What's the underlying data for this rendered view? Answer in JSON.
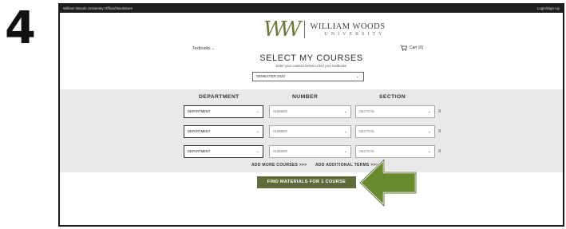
{
  "step_number": "4",
  "topbar": {
    "left_text": "William Woods University Official Bookstore",
    "right_text": "Login/Sign Up"
  },
  "logo": {
    "mark": "WW",
    "line1": "WILLIAM WOODS",
    "line2": "UNIVERSITY"
  },
  "nav": {
    "textbooks_label": "Textbooks",
    "cart_label": "Cart (0)"
  },
  "page": {
    "title": "SELECT MY COURSES",
    "subtitle": "Enter your courses below to find your textbooks"
  },
  "term_select": {
    "value": "SEMESTER 2020"
  },
  "columns": [
    "DEPARTMENT",
    "NUMBER",
    "SECTION"
  ],
  "rows": [
    {
      "department": "DEPARTMENT",
      "number": "NUMBER",
      "section": "SECTION"
    },
    {
      "department": "DEPARTMENT",
      "number": "NUMBER",
      "section": "SECTION"
    },
    {
      "department": "DEPARTMENT",
      "number": "NUMBER",
      "section": "SECTION"
    }
  ],
  "remove_label": "X",
  "links": {
    "add_more": "ADD MORE COURSES >>>",
    "add_terms": "ADD ADDITIONAL TERMS >>>"
  },
  "find_button_label": "FIND MATERIALS FOR 1 COURSE",
  "colors": {
    "brand_green": "#5f6b3a",
    "arrow_green": "#6a8a2e",
    "grey_panel": "#e9e9e9",
    "topbar": "#1e1e1e"
  }
}
